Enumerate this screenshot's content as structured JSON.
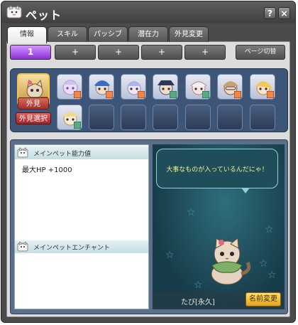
{
  "window": {
    "title": "ペット",
    "help_label": "?",
    "close_label": "×"
  },
  "tabs": [
    {
      "label": "情報",
      "active": true
    },
    {
      "label": "スキル",
      "active": false
    },
    {
      "label": "パッシブ",
      "active": false
    },
    {
      "label": "潜在力",
      "active": false
    },
    {
      "label": "外見変更",
      "active": false
    }
  ],
  "pages": {
    "buttons": [
      "1",
      "+",
      "+",
      "+",
      "+"
    ],
    "page_switch_label": "ページ切替"
  },
  "pet_slots": {
    "main_label": "外見",
    "select_appearance_label": "外見選択"
  },
  "info": {
    "main_pet_stats_header": "メインペット能力値",
    "stat_line": "最大HP +1000",
    "enchant_header": "メインペットエンチャント"
  },
  "scene": {
    "speech": "大事なものが入っているんだにゃ！",
    "pet_name": "たび[永久]",
    "rename_label": "名前変更"
  },
  "colors": {
    "active_page": "#a855e6",
    "tag_red": "#c0392b",
    "rename_gold": "#f2c23a",
    "speech_text": "#f4f48a"
  }
}
